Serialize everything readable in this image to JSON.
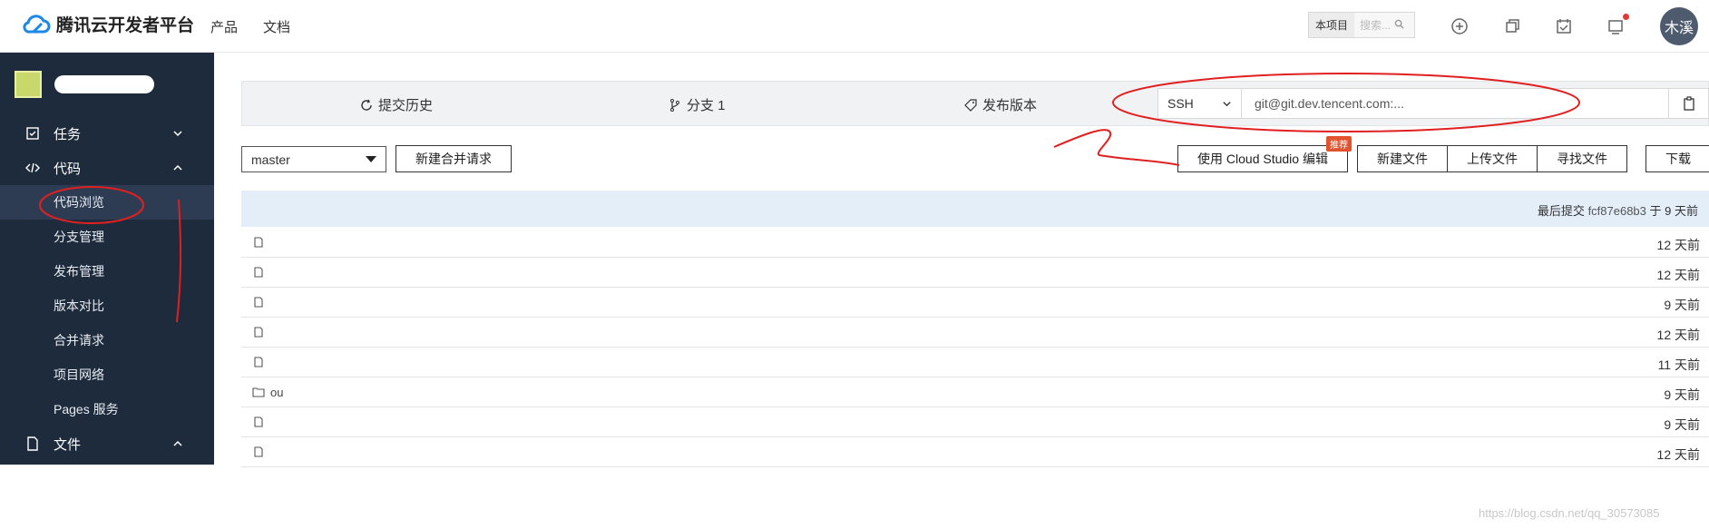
{
  "header": {
    "logo_text": "腾讯云开发者平台",
    "nav": [
      "产品",
      "文档"
    ],
    "search_scope": "本项目",
    "search_placeholder": "搜索...",
    "avatar_text": "木溪"
  },
  "sidebar": {
    "menus": [
      {
        "label": "任务",
        "icon": "task-icon",
        "expanded": false
      },
      {
        "label": "代码",
        "icon": "code-icon",
        "expanded": true
      },
      {
        "label": "文件",
        "icon": "file-icon",
        "expanded": true
      }
    ],
    "code_items": [
      "代码浏览",
      "分支管理",
      "发布管理",
      "版本对比",
      "合并请求",
      "项目网络",
      "Pages 服务"
    ],
    "active_item": "代码浏览"
  },
  "repo_bar": {
    "history": "提交历史",
    "branches": "分支 1",
    "releases": "发布版本"
  },
  "clone": {
    "protocol": "SSH",
    "url": "git@git.dev.tencent.com:..."
  },
  "toolbar": {
    "branch": "master",
    "new_merge": "新建合并请求",
    "cloud_studio": "使用 Cloud Studio 编辑",
    "badge": "推荐",
    "new_file": "新建文件",
    "upload_file": "上传文件",
    "find_file": "寻找文件",
    "download": "下载"
  },
  "commit": {
    "message": "",
    "prefix": "最后提交",
    "hash": "fcf87e68b3",
    "time": "于 9 天前"
  },
  "files": [
    {
      "type": "file",
      "name": "",
      "time": "12 天前"
    },
    {
      "type": "file",
      "name": "",
      "time": "12 天前"
    },
    {
      "type": "file",
      "name": "",
      "time": "9 天前"
    },
    {
      "type": "file",
      "name": "",
      "time": "12 天前"
    },
    {
      "type": "file",
      "name": "",
      "time": "11 天前"
    },
    {
      "type": "folder",
      "name": "ou",
      "time": "9 天前"
    },
    {
      "type": "file",
      "name": "",
      "time": "9 天前"
    },
    {
      "type": "file",
      "name": "",
      "time": "12 天前"
    }
  ],
  "watermark": "https://blog.csdn.net/qq_30573085",
  "colors": {
    "sidebar": "#1e2b3c",
    "commit_bar": "#e4eef9",
    "annotation": "#e02020"
  }
}
